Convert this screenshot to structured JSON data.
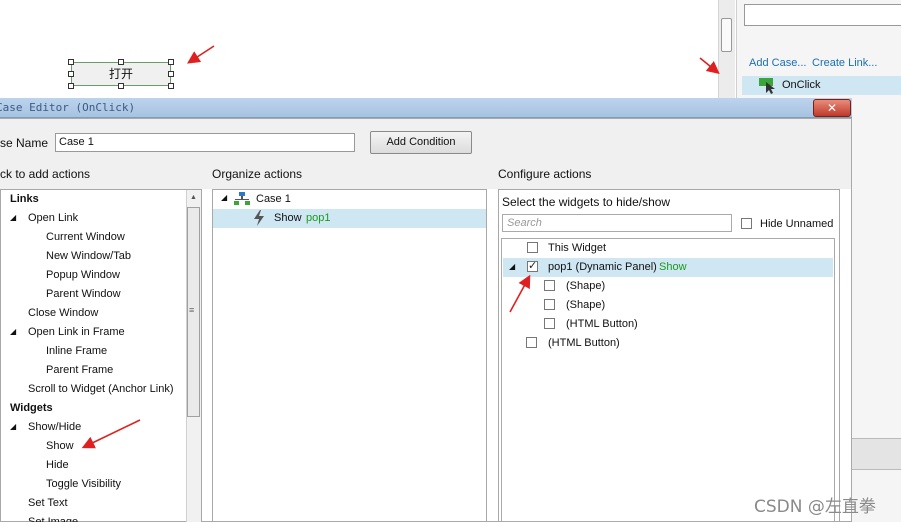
{
  "canvas": {
    "open_button_label": "打开"
  },
  "right_pane": {
    "add_case_link": "Add Case...",
    "create_link_link": "Create Link...",
    "onclick_label": "OnClick"
  },
  "dialog": {
    "title": "Case Editor (OnClick)",
    "case_name_label": "se Name",
    "case_name_value": "Case 1",
    "add_condition_label": "Add Condition",
    "col1_title": "ck to add actions",
    "col2_title": "Organize actions",
    "col3_title": "Configure actions"
  },
  "actions_tree": [
    {
      "label": "Links",
      "level": 0,
      "bold": true
    },
    {
      "label": "Open Link",
      "level": 1,
      "expanded": true
    },
    {
      "label": "Current Window",
      "level": 2
    },
    {
      "label": "New Window/Tab",
      "level": 2
    },
    {
      "label": "Popup Window",
      "level": 2
    },
    {
      "label": "Parent Window",
      "level": 2
    },
    {
      "label": "Close Window",
      "level": 1
    },
    {
      "label": "Open Link in Frame",
      "level": 1,
      "expanded": true
    },
    {
      "label": "Inline Frame",
      "level": 2
    },
    {
      "label": "Parent Frame",
      "level": 2
    },
    {
      "label": "Scroll to Widget (Anchor Link)",
      "level": 1
    },
    {
      "label": "Widgets",
      "level": 0,
      "bold": true
    },
    {
      "label": "Show/Hide",
      "level": 1,
      "expanded": true
    },
    {
      "label": "Show",
      "level": 2
    },
    {
      "label": "Hide",
      "level": 2
    },
    {
      "label": "Toggle Visibility",
      "level": 2
    },
    {
      "label": "Set Text",
      "level": 1
    },
    {
      "label": "Set Image",
      "level": 1
    }
  ],
  "organize": {
    "case_label": "Case 1",
    "action_verb": "Show",
    "action_target": "pop1"
  },
  "configure": {
    "select_title": "Select the widgets to hide/show",
    "search_placeholder": "Search",
    "hide_unnamed_label": "Hide Unnamed",
    "widgets": [
      {
        "label": "This Widget",
        "checked": false,
        "indent": 1
      },
      {
        "label": "pop1 (Dynamic Panel)",
        "status": "Show",
        "checked": true,
        "indent": 1,
        "highlight": true
      },
      {
        "label": "(Shape)",
        "checked": false,
        "indent": 2
      },
      {
        "label": "(Shape)",
        "checked": false,
        "indent": 2
      },
      {
        "label": "(HTML Button)",
        "checked": false,
        "indent": 2
      },
      {
        "label": "(HTML Button)",
        "checked": false,
        "indent": 0
      }
    ]
  },
  "watermark": "CSDN @左直拳",
  "colors": {
    "highlight": "#cfe6f3",
    "link": "#1a6fb5",
    "green": "#1c9a1c",
    "arrow": "#e02020"
  }
}
